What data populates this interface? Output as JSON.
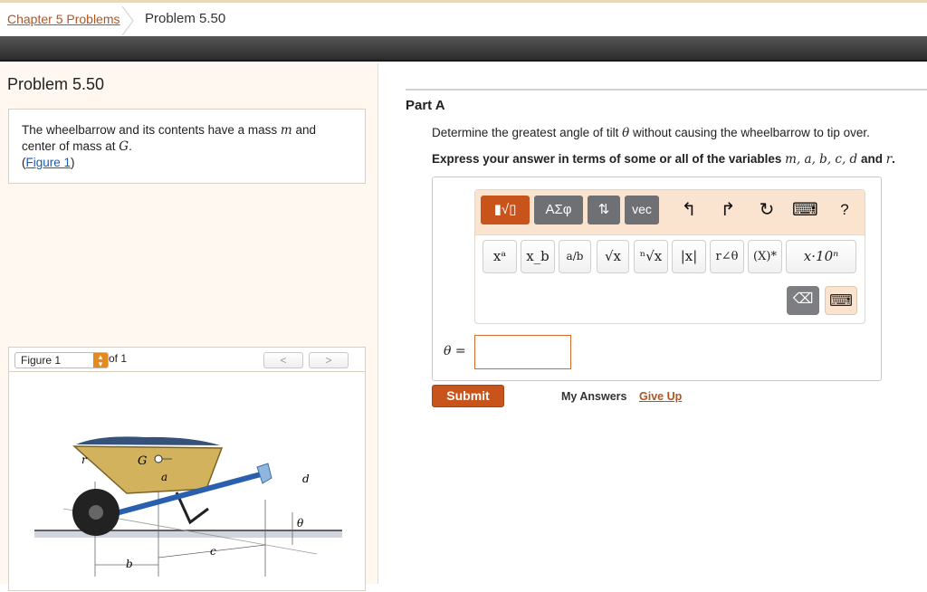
{
  "breadcrumb": {
    "parent": "Chapter 5 Problems",
    "current": "Problem 5.50"
  },
  "problem": {
    "title": "Problem 5.50",
    "statement_line1_a": "The wheelbarrow and its contents have a mass ",
    "statement_var_m": "m",
    "statement_line1_b": " and",
    "statement_line2_a": "center of mass at ",
    "statement_var_g": "G",
    "statement_line2_b": ".",
    "figure_open": "(",
    "figure_link": "Figure 1",
    "figure_close": ")"
  },
  "figure": {
    "select_value": "Figure 1",
    "of_label": "of 1",
    "prev": "<",
    "next": ">",
    "labels": {
      "r": "r",
      "g": "G",
      "a": "a",
      "d": "d",
      "theta": "θ",
      "b": "b",
      "c": "c"
    }
  },
  "part": {
    "title": "Part A",
    "question_a": "Determine the greatest angle of tilt ",
    "question_var": "θ",
    "question_b": " without causing the wheelbarrow to tip over.",
    "instruction_a": "Express your answer in terms of some or all of the variables ",
    "instruction_vars": "m, a, b, c, d",
    "instruction_and": " and ",
    "instruction_var_r": "r",
    "instruction_end": "."
  },
  "editor": {
    "toolbar": {
      "templates": "▮√▯",
      "greek": "ΑΣφ",
      "sort": "⇅",
      "vec": "vec",
      "undo": "↰",
      "redo": "↱",
      "reset": "↻",
      "keyboard": "⌨",
      "help": "?"
    },
    "symbols": [
      "xᵃ",
      "x_b",
      "a/b",
      "√x",
      "ⁿ√x",
      "|x|",
      "r∠θ",
      "(X)*",
      "x·10ⁿ"
    ],
    "delete_icon": "⌫",
    "keyboard_icon": "⌨"
  },
  "answer": {
    "label": "θ =",
    "value": ""
  },
  "actions": {
    "submit": "Submit",
    "my_answers": "My Answers",
    "give_up": "Give Up"
  },
  "colors": {
    "accent": "#c8541b",
    "link": "#b3541e",
    "figure_link": "#1e5bb5"
  }
}
